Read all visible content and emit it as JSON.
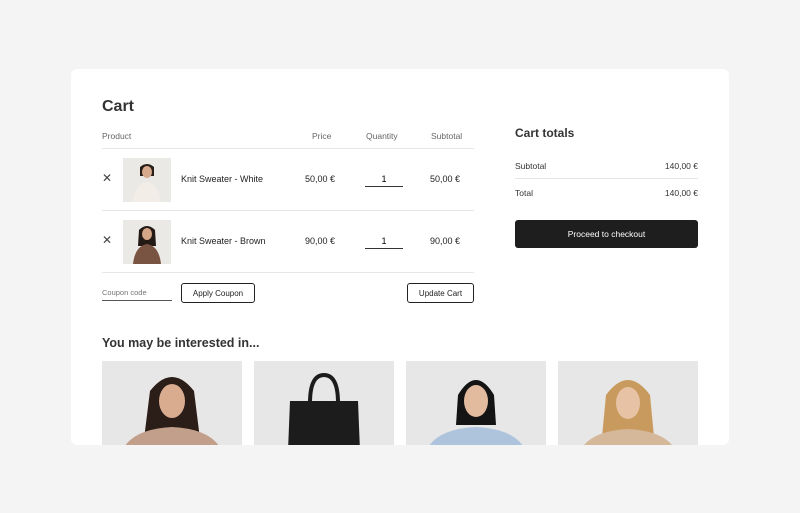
{
  "cart": {
    "title": "Cart",
    "columns": {
      "product": "Product",
      "price": "Price",
      "quantity": "Quantity",
      "subtotal": "Subtotal"
    },
    "items": [
      {
        "name": "Knit Sweater - White",
        "price": "50,00 €",
        "quantity": "1",
        "subtotal": "50,00 €",
        "remove_icon": "✕",
        "thumb_color": "#f1ece6"
      },
      {
        "name": "Knit Sweater - Brown",
        "price": "90,00 €",
        "quantity": "1",
        "subtotal": "90,00 €",
        "remove_icon": "✕",
        "thumb_color": "#7a5443"
      }
    ],
    "coupon_placeholder": "Coupon code",
    "apply_label": "Apply Coupon",
    "update_label": "Update Cart"
  },
  "totals": {
    "title": "Cart totals",
    "subtotal_label": "Subtotal",
    "subtotal_value": "140,00 €",
    "total_label": "Total",
    "total_value": "140,00 €",
    "checkout_label": "Proceed to checkout"
  },
  "recommendations": {
    "title": "You may be interested in...",
    "items": [
      {
        "type": "person",
        "hair": "#2b1d17",
        "top": "#c29f8a",
        "skin": "#d9ab8f"
      },
      {
        "type": "bag",
        "bag": "#1c1c1c"
      },
      {
        "type": "person",
        "hair": "#141414",
        "top": "#aec4dc",
        "skin": "#e2bb9f"
      },
      {
        "type": "person",
        "hair": "#c99a5e",
        "top": "#d5b89a",
        "skin": "#e7c2a5"
      }
    ]
  }
}
